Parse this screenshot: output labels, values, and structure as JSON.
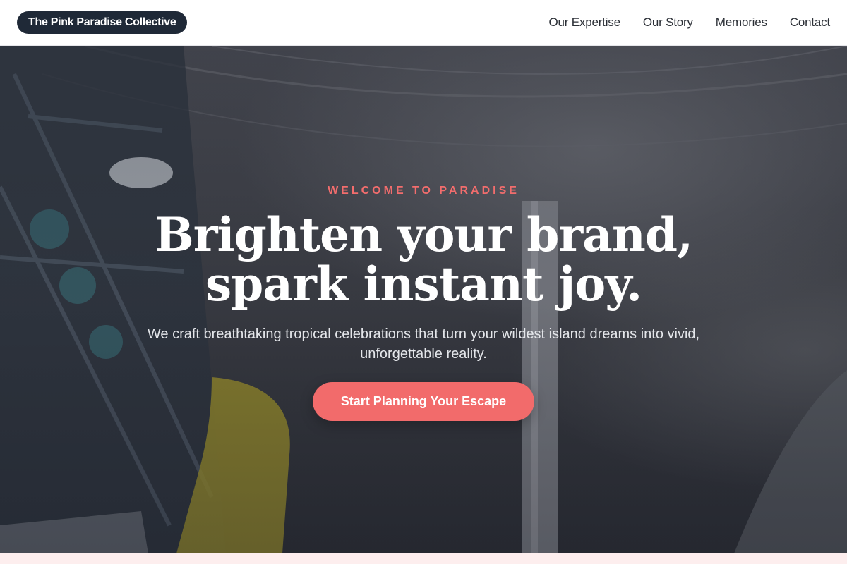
{
  "header": {
    "brand": "The Pink Paradise Collective",
    "nav": [
      {
        "label": "Our Expertise"
      },
      {
        "label": "Our Story"
      },
      {
        "label": "Memories"
      },
      {
        "label": "Contact"
      }
    ]
  },
  "hero": {
    "eyebrow": "WELCOME TO PARADISE",
    "headline_line1": "Brighten your brand,",
    "headline_line2": "spark instant joy.",
    "subtext": "We craft breathtaking tropical celebrations that turn your wildest island dreams into vivid, unforgettable reality.",
    "cta": "Start Planning Your Escape"
  },
  "colors": {
    "brand_bg": "#1f2937",
    "accent": "#f26b6b",
    "eyebrow": "#f26d6d",
    "footer_strip": "#fdeeee"
  }
}
